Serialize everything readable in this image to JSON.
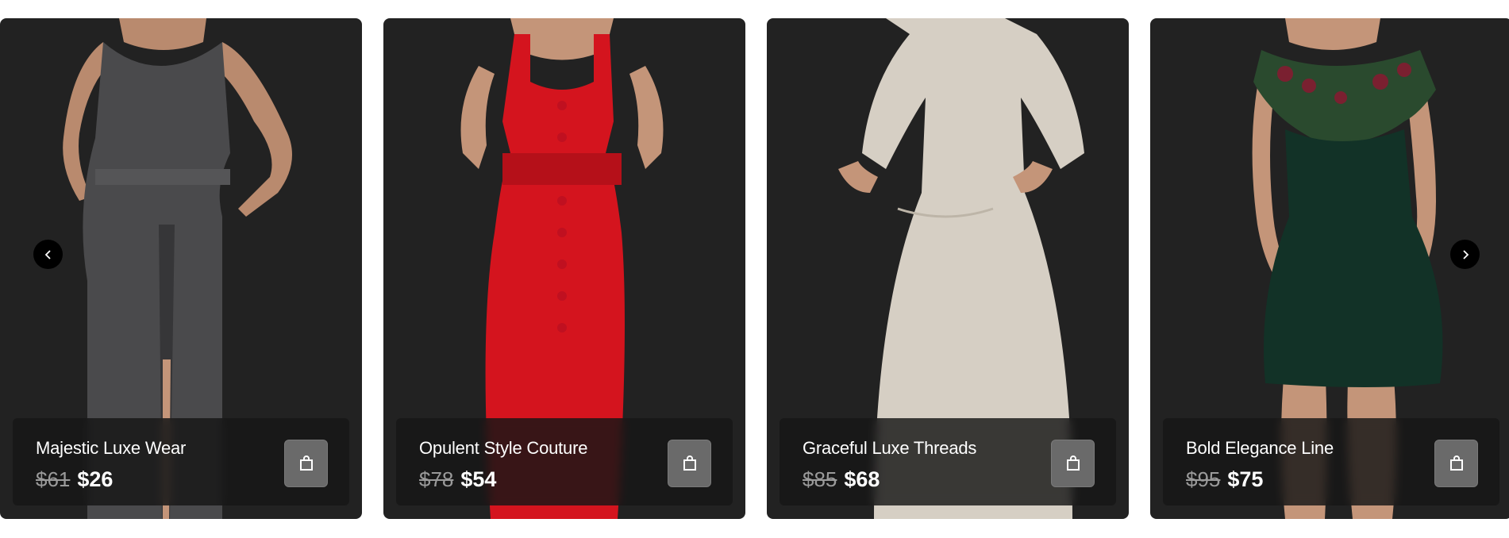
{
  "carousel": {
    "prev_icon": "chevron-left-icon",
    "next_icon": "chevron-right-icon",
    "products": [
      {
        "name": "Majestic Luxe Wear",
        "old_price": "$61",
        "new_price": "$26",
        "dress_color": "#4a4a4c",
        "action_icon": "shopping-bag-icon"
      },
      {
        "name": "Opulent Style Couture",
        "old_price": "$78",
        "new_price": "$54",
        "dress_color": "#d4141e",
        "action_icon": "shopping-bag-icon"
      },
      {
        "name": "Graceful Luxe Threads",
        "old_price": "$85",
        "new_price": "$68",
        "dress_color": "#d6cfc4",
        "action_icon": "shopping-bag-icon"
      },
      {
        "name": "Bold Elegance Line",
        "old_price": "$95",
        "new_price": "$75",
        "dress_color": "#123227",
        "action_icon": "shopping-bag-icon"
      }
    ]
  },
  "colors": {
    "card_bg": "#222222",
    "page_bg": "#ffffff",
    "button_bg": "#6a6a6a"
  }
}
